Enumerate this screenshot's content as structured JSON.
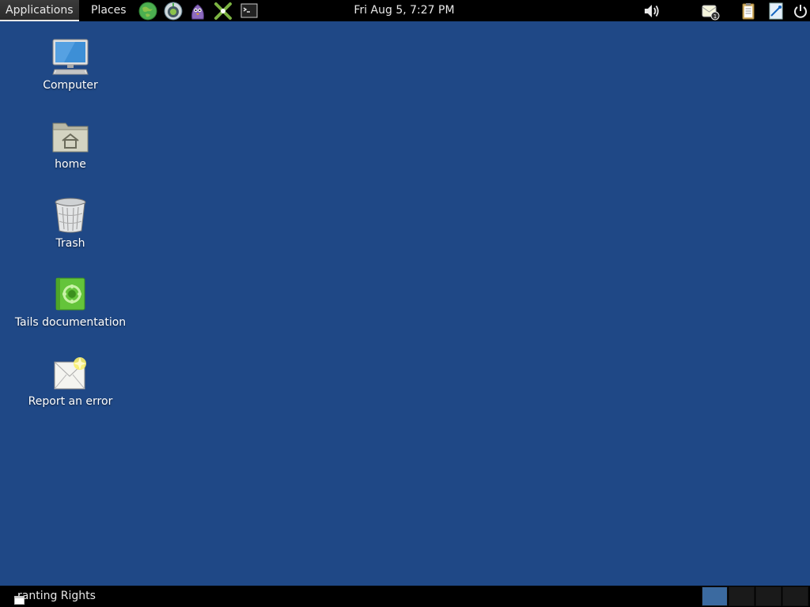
{
  "top_panel": {
    "applications_label": "Applications",
    "places_label": "Places",
    "launchers": [
      "globe-icon",
      "onion-browser-icon",
      "pidgin-icon",
      "keepassx-icon",
      "terminal-icon"
    ],
    "clock": "Fri Aug  5,  7:27 PM",
    "tray": [
      "volume-icon",
      "notification-icon",
      "clipboard-icon",
      "accessibility-icon",
      "power-icon"
    ]
  },
  "desktop": {
    "icons": [
      {
        "label": "Computer",
        "icon": "computer-icon"
      },
      {
        "label": "home",
        "icon": "home-folder-icon"
      },
      {
        "label": "Trash",
        "icon": "trash-icon"
      },
      {
        "label": "Tails documentation",
        "icon": "documentation-icon"
      },
      {
        "label": "Report an error",
        "icon": "report-error-icon"
      }
    ],
    "background_color": "#1f4886"
  },
  "bottom_panel": {
    "taskbar_item": "ranting Rights",
    "workspaces": [
      {
        "active": true
      },
      {
        "active": false
      },
      {
        "active": false
      },
      {
        "active": false
      }
    ]
  }
}
